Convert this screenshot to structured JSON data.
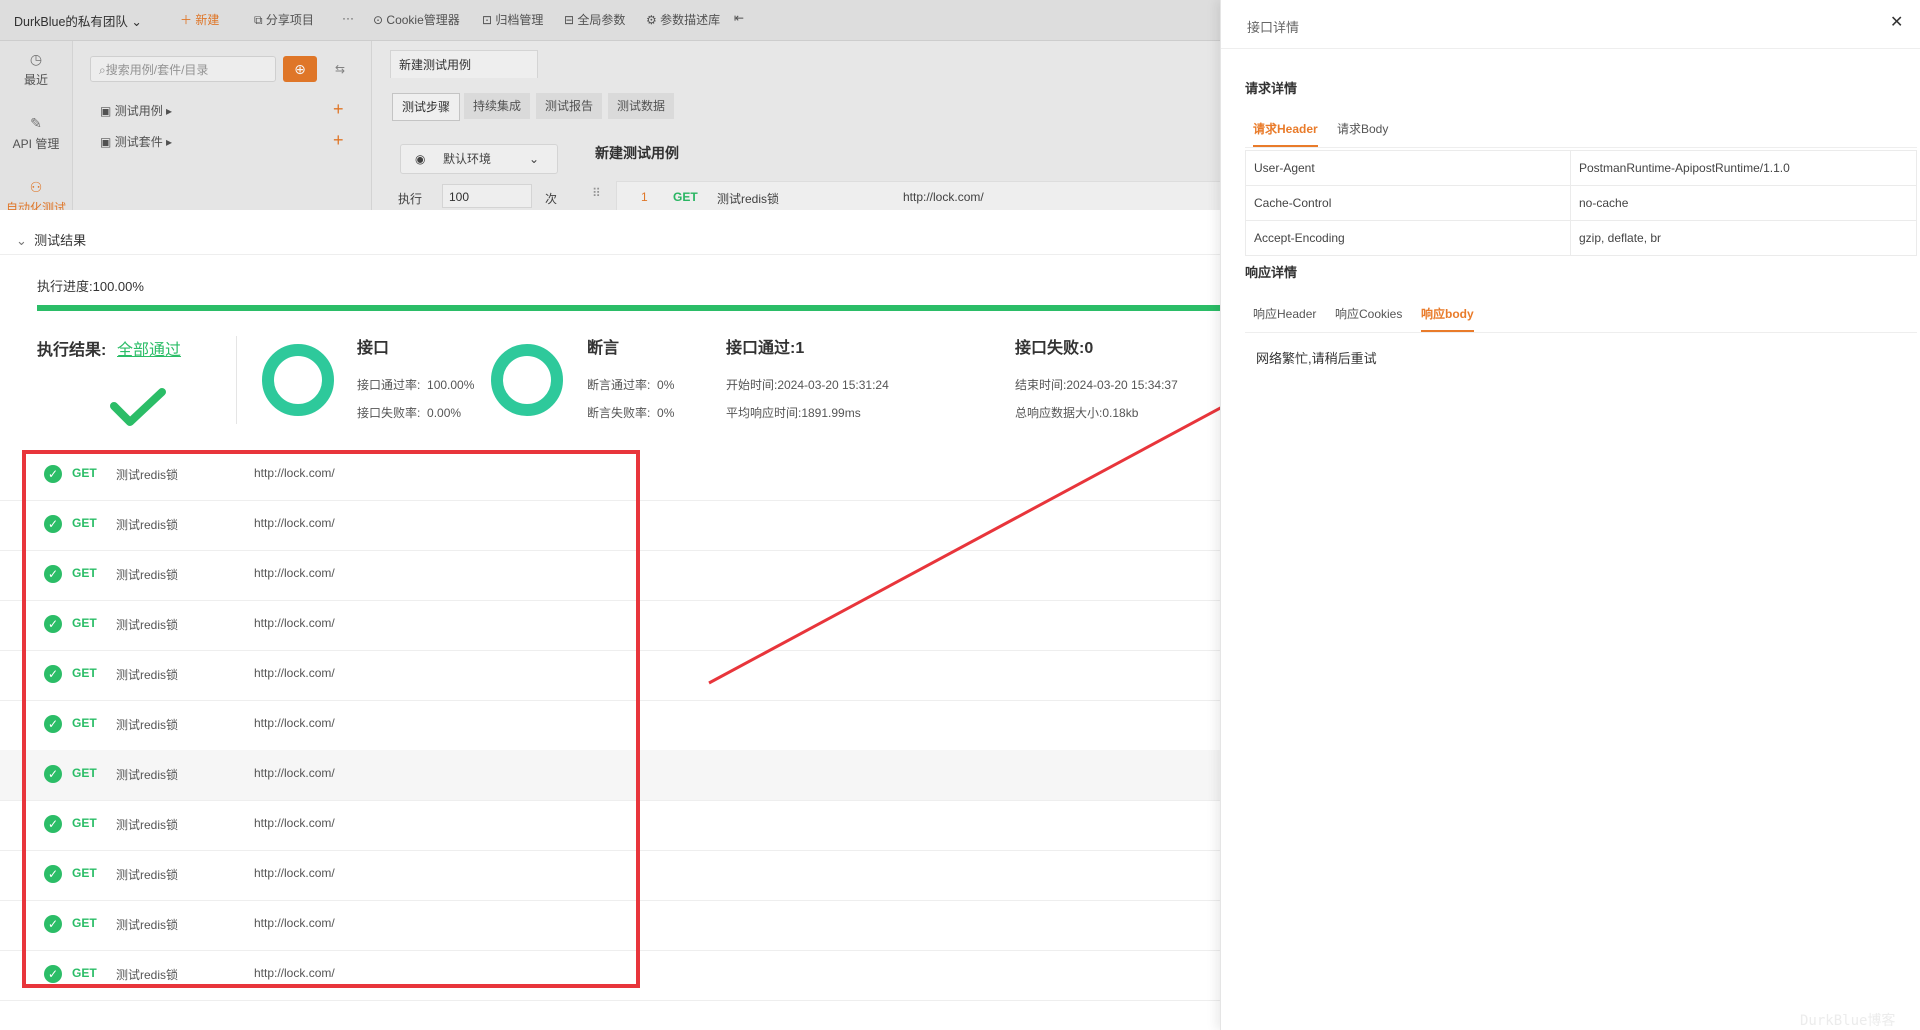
{
  "topbar": {
    "team": "DurkBlue的私有团队",
    "new": "新建",
    "share": "分享项目",
    "more": "···",
    "cookie": "Cookie管理器",
    "archive": "归档管理",
    "globals": "全局参数",
    "params": "参数描述库"
  },
  "nav": {
    "recent": "最近",
    "api": "API 管理",
    "auto": "自动化测试"
  },
  "tree": {
    "search_placeholder": "搜索用例/套件/目录",
    "cases": "测试用例",
    "suites": "测试套件"
  },
  "workarea": {
    "tab": "新建测试用例",
    "subtabs": [
      "测试步骤",
      "持续集成",
      "测试报告",
      "测试数据"
    ],
    "env": "默认环境",
    "step_title": "新建测试用例",
    "exec_label": "执行",
    "exec_count": "100",
    "exec_unit": "次",
    "step_index": "1",
    "step_method": "GET",
    "step_name": "测试redis锁",
    "step_url": "http://lock.com/"
  },
  "results": {
    "header": "测试结果",
    "progress_label": "执行进度:100.00%",
    "progress_percent": 100,
    "exec_result_label": "执行结果:",
    "exec_result_value": "全部通过",
    "api_title": "接口",
    "api_pass_rate_label": "接口通过率:",
    "api_pass_rate": "100.00%",
    "api_fail_rate_label": "接口失败率:",
    "api_fail_rate": "0.00%",
    "assert_title": "断言",
    "assert_pass_rate_label": "断言通过率:",
    "assert_pass_rate": "0%",
    "assert_fail_rate_label": "断言失败率:",
    "assert_fail_rate": "0%",
    "api_pass_title": "接口通过:1",
    "start_time": "开始时间:2024-03-20 15:31:24",
    "avg_time": "平均响应时间:1891.99ms",
    "api_fail_title": "接口失败:0",
    "end_time": "结束时间:2024-03-20 15:34:37",
    "total_size": "总响应数据大小:0.18kb"
  },
  "requests": [
    {
      "method": "GET",
      "name": "测试redis锁",
      "url": "http://lock.com/"
    },
    {
      "method": "GET",
      "name": "测试redis锁",
      "url": "http://lock.com/"
    },
    {
      "method": "GET",
      "name": "测试redis锁",
      "url": "http://lock.com/"
    },
    {
      "method": "GET",
      "name": "测试redis锁",
      "url": "http://lock.com/"
    },
    {
      "method": "GET",
      "name": "测试redis锁",
      "url": "http://lock.com/"
    },
    {
      "method": "GET",
      "name": "测试redis锁",
      "url": "http://lock.com/"
    },
    {
      "method": "GET",
      "name": "测试redis锁",
      "url": "http://lock.com/"
    },
    {
      "method": "GET",
      "name": "测试redis锁",
      "url": "http://lock.com/"
    },
    {
      "method": "GET",
      "name": "测试redis锁",
      "url": "http://lock.com/"
    },
    {
      "method": "GET",
      "name": "测试redis锁",
      "url": "http://lock.com/"
    },
    {
      "method": "GET",
      "name": "测试redis锁",
      "url": "http://lock.com/"
    }
  ],
  "drawer": {
    "title": "接口详情",
    "request_section": "请求详情",
    "req_tabs": [
      "请求Header",
      "请求Body"
    ],
    "headers": [
      {
        "key": "User-Agent",
        "value": "PostmanRuntime-ApipostRuntime/1.1.0"
      },
      {
        "key": "Cache-Control",
        "value": "no-cache"
      },
      {
        "key": "Accept-Encoding",
        "value": "gzip, deflate, br"
      }
    ],
    "response_section": "响应详情",
    "resp_tabs": [
      "响应Header",
      "响应Cookies",
      "响应body"
    ],
    "response_body": "网络繁忙,请稍后重试"
  },
  "watermark": "DurkBlue博客",
  "colors": {
    "accent": "#e97b2a",
    "success": "#2bbd67",
    "ring": "#2ec99b",
    "annotation_red": "#e8353b"
  }
}
